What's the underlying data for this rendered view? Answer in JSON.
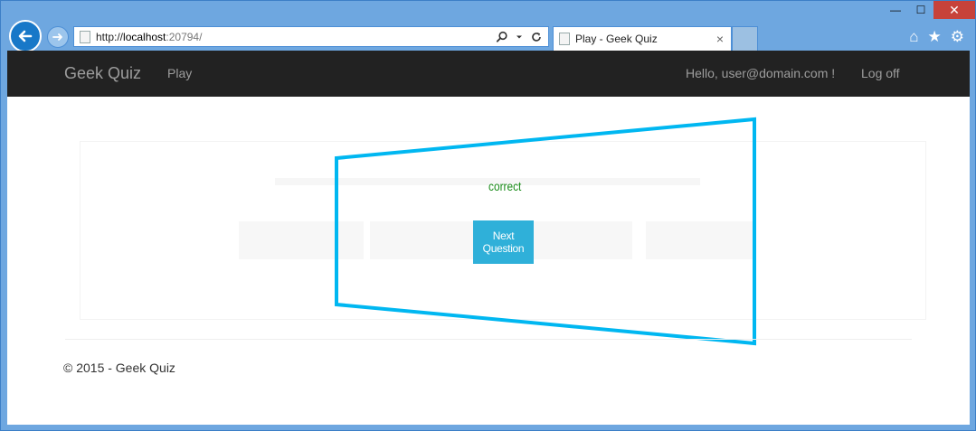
{
  "browser": {
    "address": {
      "prefix": "http://",
      "host": "localhost",
      "rest": ":20794/"
    },
    "tab_title": "Play - Geek Quiz",
    "tab_close": "×",
    "window_controls": {
      "minimize": "—",
      "maximize": "☐",
      "close": "✕"
    },
    "icons": {
      "home": "⌂",
      "favorites": "★",
      "settings": "⚙"
    }
  },
  "navbar": {
    "brand": "Geek Quiz",
    "play": "Play",
    "hello": "Hello, user@domain.com !",
    "logoff": "Log off"
  },
  "quiz": {
    "result": "correct",
    "result_color": "#1a8c1a",
    "next_button": "Next Question",
    "accent_color": "#00b7f1"
  },
  "footer": {
    "copyright": "© 2015 - Geek Quiz"
  }
}
